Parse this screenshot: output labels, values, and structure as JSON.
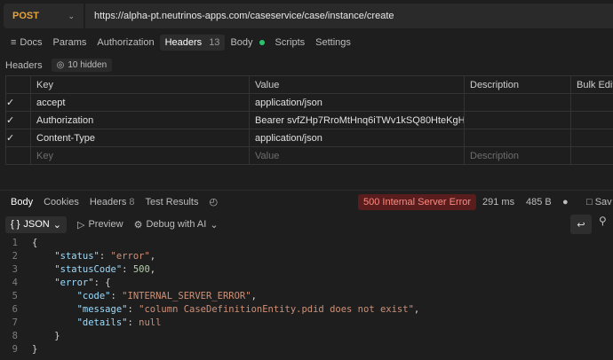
{
  "request": {
    "method": "POST",
    "url": "https://alpha-pt.neutrinos-apps.com/caseservice/case/instance/create"
  },
  "req_tabs": [
    {
      "label": "Docs"
    },
    {
      "label": "Params"
    },
    {
      "label": "Authorization"
    },
    {
      "label": "Headers",
      "count": "13"
    },
    {
      "label": "Body"
    },
    {
      "label": "Scripts"
    },
    {
      "label": "Settings"
    }
  ],
  "headers_section": {
    "title": "Headers",
    "hidden": "10 hidden"
  },
  "headers_table": {
    "columns": [
      "Key",
      "Value",
      "Description",
      "Bulk Edit"
    ],
    "rows": [
      {
        "key": "accept",
        "value": "application/json",
        "description": ""
      },
      {
        "key": "Authorization",
        "value": "Bearer svfZHp7RroMtHnq6iTWv1kSQ80HteKgH...",
        "description": ""
      },
      {
        "key": "Content-Type",
        "value": "application/json",
        "description": ""
      }
    ],
    "placeholders": {
      "key": "Key",
      "value": "Value",
      "description": "Description"
    }
  },
  "response": {
    "tabs": [
      {
        "label": "Body"
      },
      {
        "label": "Cookies"
      },
      {
        "label": "Headers",
        "count": "8"
      },
      {
        "label": "Test Results"
      }
    ],
    "status": "500 Internal Server Error",
    "time": "291 ms",
    "size": "485 B",
    "save_label": "Sav"
  },
  "format_bar": {
    "format": "JSON",
    "preview": "Preview",
    "debug": "Debug with AI"
  },
  "code_lines": [
    {
      "n": "1",
      "t": "{"
    },
    {
      "n": "2",
      "t": "    \"status\": \"error\","
    },
    {
      "n": "3",
      "t": "    \"statusCode\": 500,"
    },
    {
      "n": "4",
      "t": "    \"error\": {"
    },
    {
      "n": "5",
      "t": "        \"code\": \"INTERNAL_SERVER_ERROR\","
    },
    {
      "n": "6",
      "t": "        \"message\": \"column CaseDefinitionEntity.pdid does not exist\","
    },
    {
      "n": "7",
      "t": "        \"details\": null"
    },
    {
      "n": "8",
      "t": "    }"
    },
    {
      "n": "9",
      "t": "}"
    }
  ],
  "colors": {
    "method": "#e6a23c",
    "status_bg": "#5a1d1d",
    "status_fg": "#ff8a80",
    "body_dot": "#27c46b"
  }
}
